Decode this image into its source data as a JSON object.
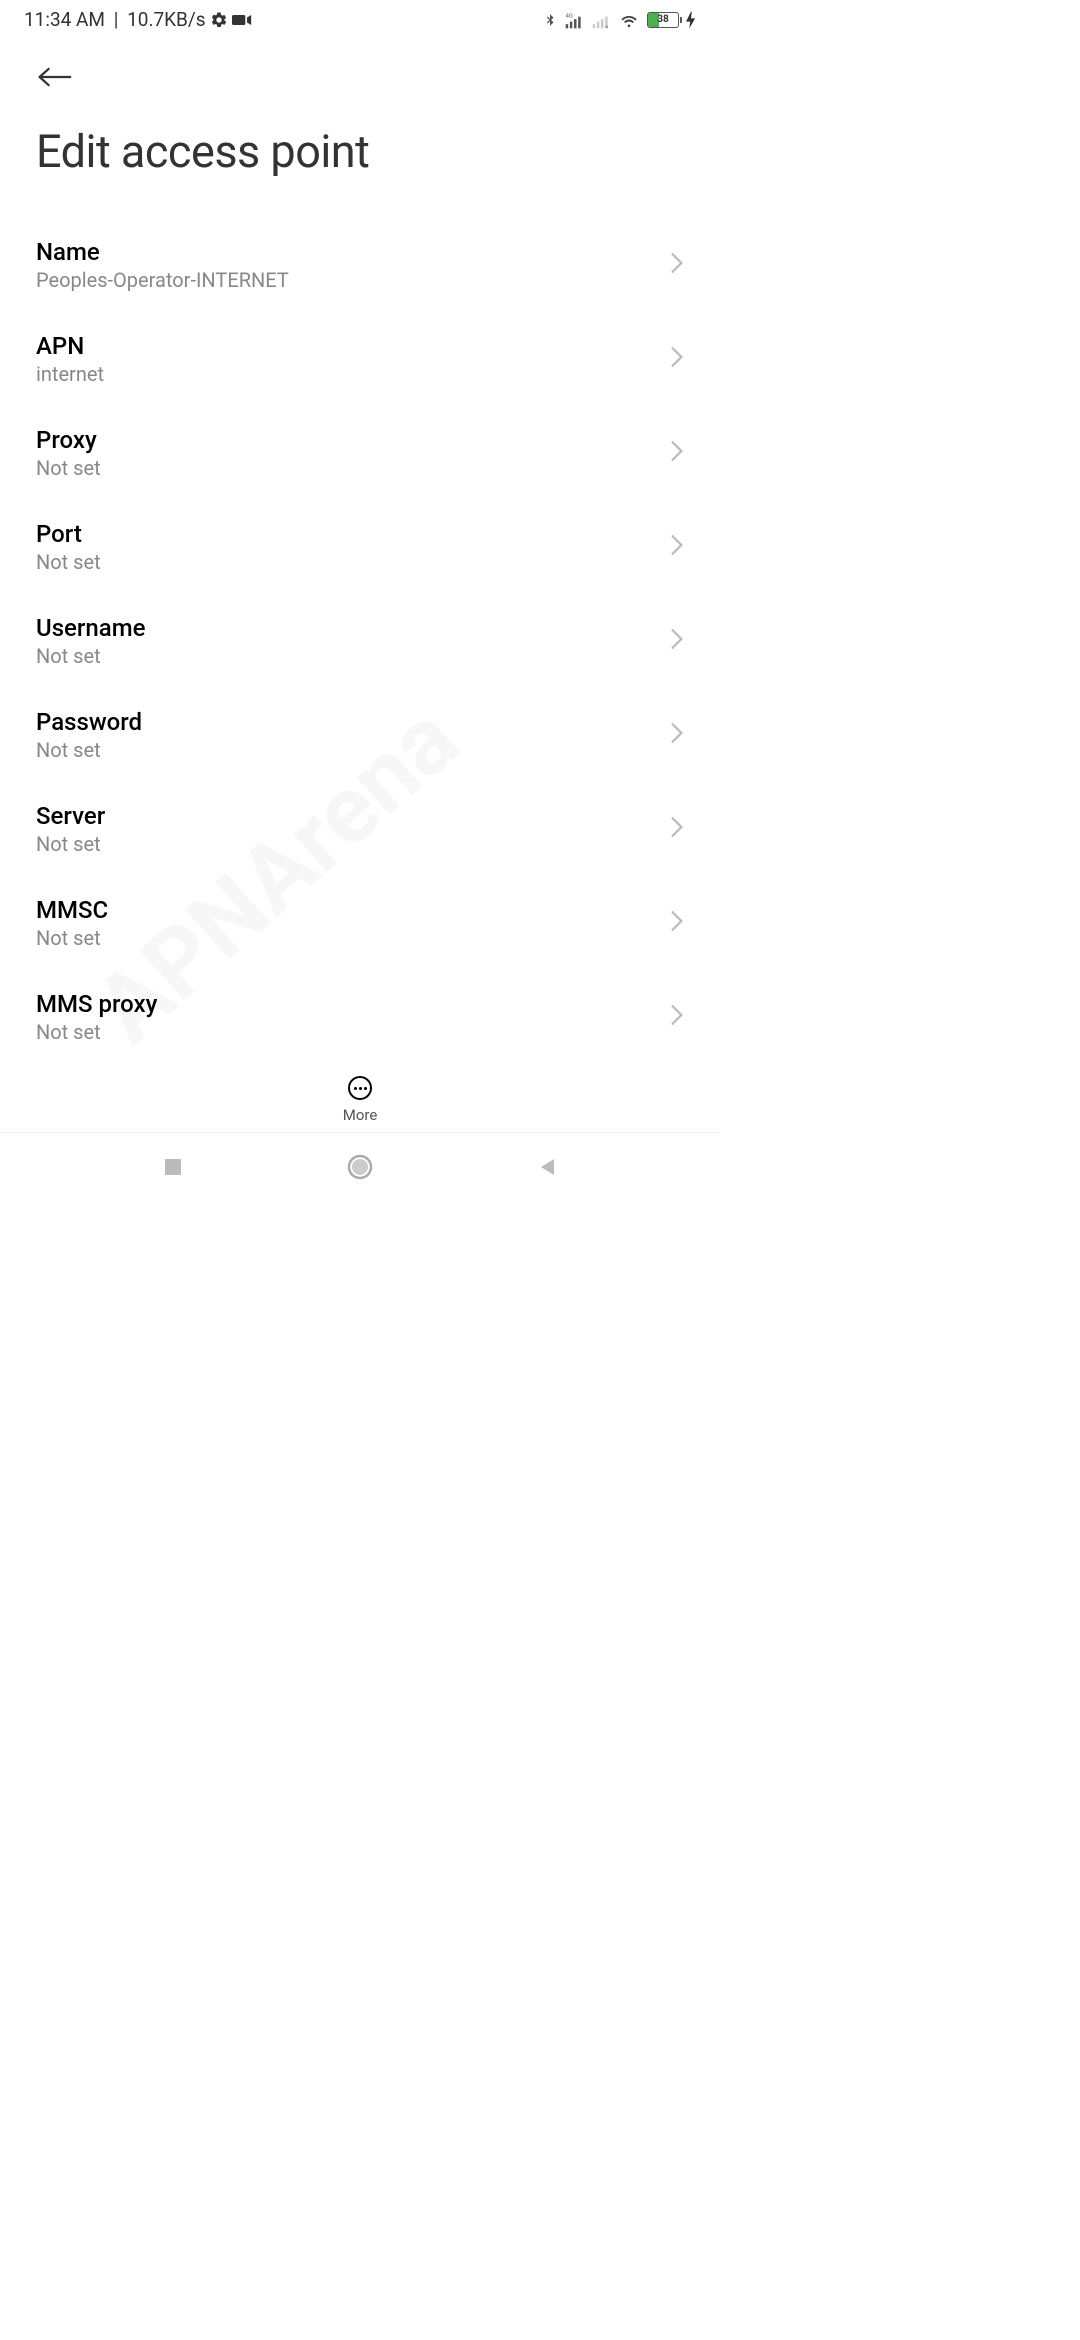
{
  "status": {
    "time": "11:34 AM",
    "data_rate": "10.7KB/s",
    "battery_percent": "38"
  },
  "header": {
    "title": "Edit access point"
  },
  "settings": [
    {
      "label": "Name",
      "value": "Peoples-Operator-INTERNET"
    },
    {
      "label": "APN",
      "value": "internet"
    },
    {
      "label": "Proxy",
      "value": "Not set"
    },
    {
      "label": "Port",
      "value": "Not set"
    },
    {
      "label": "Username",
      "value": "Not set"
    },
    {
      "label": "Password",
      "value": "Not set"
    },
    {
      "label": "Server",
      "value": "Not set"
    },
    {
      "label": "MMSC",
      "value": "Not set"
    },
    {
      "label": "MMS proxy",
      "value": "Not set"
    }
  ],
  "toolbar": {
    "more_label": "More"
  },
  "watermark": "APNArena"
}
